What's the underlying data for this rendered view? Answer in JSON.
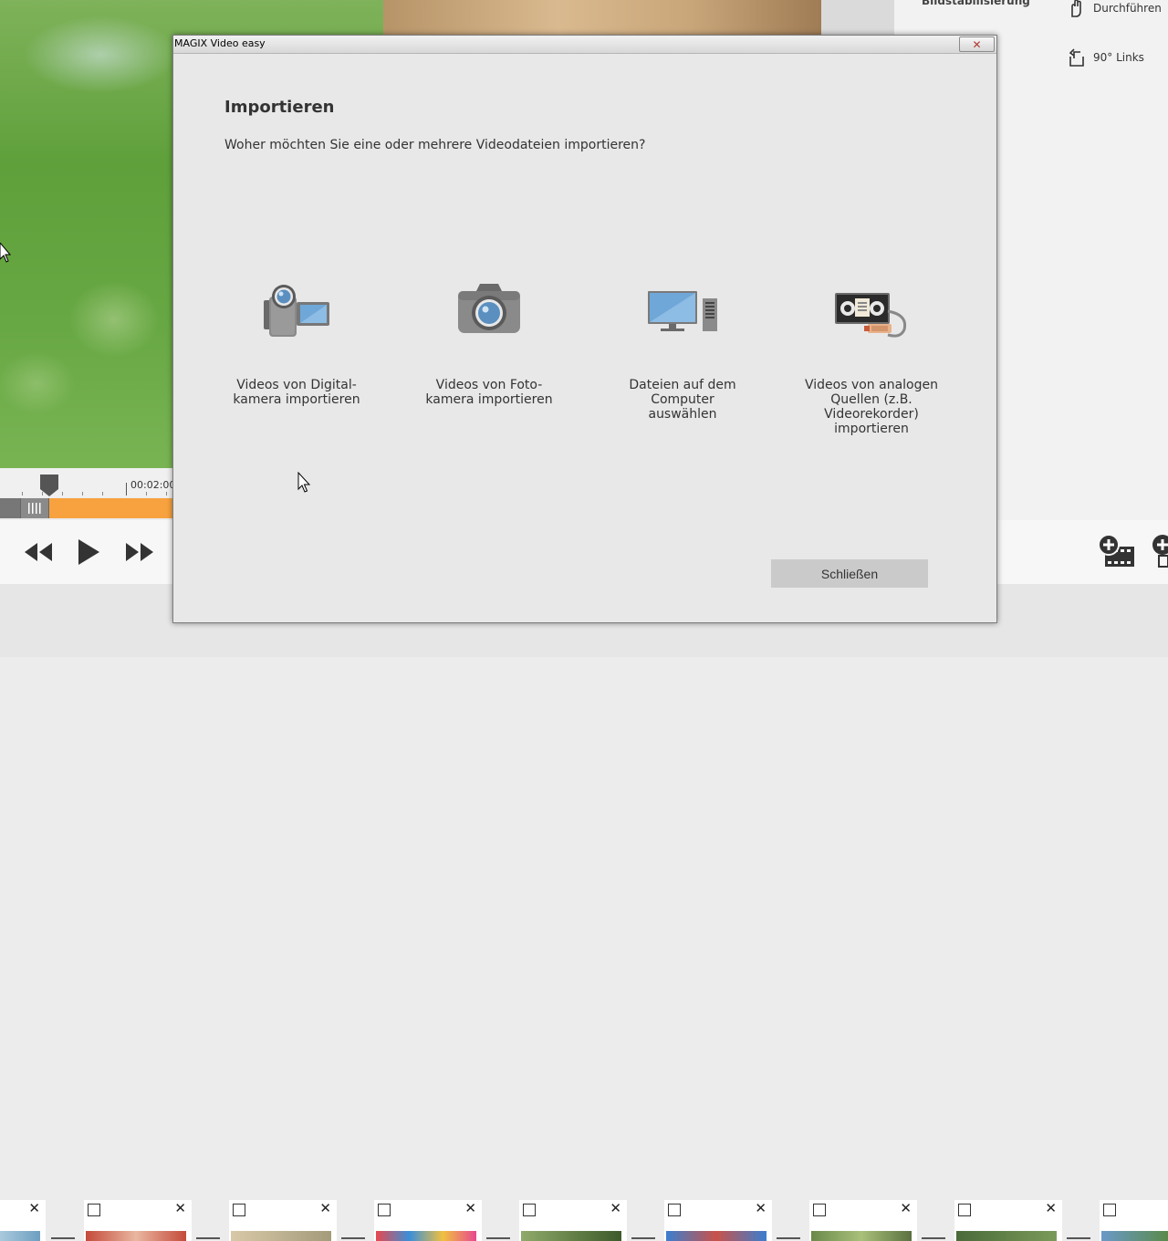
{
  "dialog": {
    "window_title": "MAGIX Video easy",
    "close_glyph": "✕",
    "heading": "Importieren",
    "question": "Woher möchten Sie eine oder mehrere Videodateien importieren?",
    "options": [
      {
        "label": "Videos von Digital-\nkamera importieren",
        "icon": "camcorder-icon"
      },
      {
        "label": "Videos von Foto-\nkamera importieren",
        "icon": "photo-camera-icon"
      },
      {
        "label": "Dateien auf dem\nComputer\nauswählen",
        "icon": "computer-icon"
      },
      {
        "label": "Videos von analogen\nQuellen (z.B.\nVideorekorder)\nimportieren",
        "icon": "vhs-recorder-icon"
      }
    ],
    "close_button": "Schließen"
  },
  "right_panel": {
    "stabilize_label": "Bildstabilisierung",
    "perform_label": "Durchführen",
    "rotate_left_label": "90° Links"
  },
  "timeline": {
    "time_mark": "00:02:00"
  },
  "colors": {
    "accent_orange": "#f7a23f",
    "dialog_bg": "#e8e8e8",
    "button_gray": "#cacaca"
  },
  "thumbnails": [
    {
      "checked": false
    },
    {
      "checked": false
    },
    {
      "checked": false
    },
    {
      "checked": false
    },
    {
      "checked": false
    },
    {
      "checked": false
    },
    {
      "checked": false
    },
    {
      "checked": false
    }
  ]
}
